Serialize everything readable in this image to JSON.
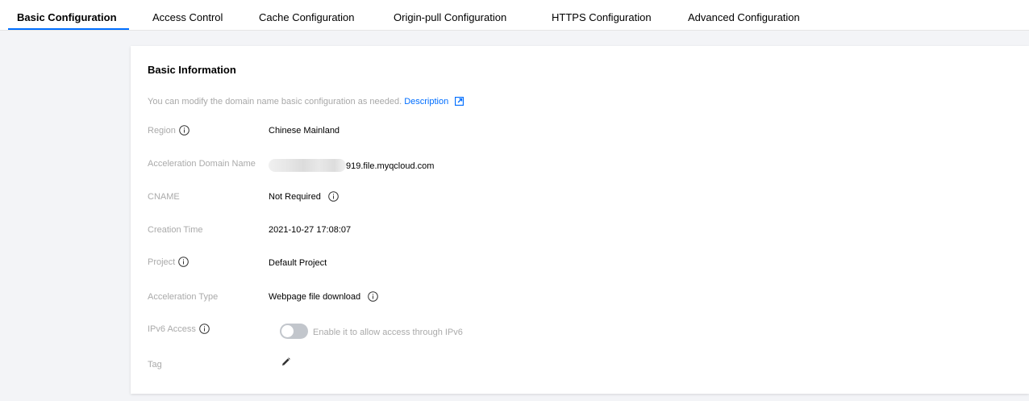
{
  "tabs": [
    {
      "label": "Basic Configuration",
      "active": true
    },
    {
      "label": "Access Control",
      "active": false
    },
    {
      "label": "Cache Configuration",
      "active": false
    },
    {
      "label": "Origin-pull Configuration",
      "active": false
    },
    {
      "label": "HTTPS Configuration",
      "active": false
    },
    {
      "label": "Advanced Configuration",
      "active": false
    }
  ],
  "card": {
    "title": "Basic Information",
    "description": "You can modify the domain name basic configuration as needed.",
    "description_link": "Description"
  },
  "rows": {
    "region": {
      "label": "Region",
      "value": "Chinese Mainland"
    },
    "domain": {
      "label": "Acceleration Domain Name",
      "value": "919.file.myqcloud.com"
    },
    "cname": {
      "label": "CNAME",
      "value": "Not Required"
    },
    "creation_time": {
      "label": "Creation Time",
      "value": "2021-10-27 17:08:07"
    },
    "project": {
      "label": "Project",
      "value": "Default Project"
    },
    "acceleration_type": {
      "label": "Acceleration Type",
      "value": "Webpage file download"
    },
    "ipv6": {
      "label": "IPv6 Access",
      "value": "Enable it to allow access through IPv6",
      "enabled": false
    },
    "tag": {
      "label": "Tag"
    }
  },
  "colors": {
    "accent": "#006eff",
    "background": "#f3f4f7",
    "label": "#aaaaaa",
    "toggle_off": "#c2c6cc"
  },
  "icons": {
    "info": "info-circle-icon",
    "external_link": "external-link-icon",
    "edit": "pencil-icon"
  }
}
